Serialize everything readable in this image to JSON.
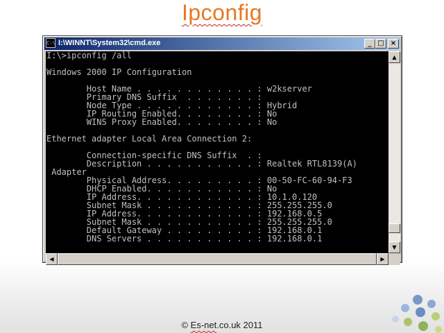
{
  "slide": {
    "title": "Ipconfig",
    "footer_pre": "© ",
    "footer_squiggle": "Es-net",
    "footer_post": ".co.uk 2011"
  },
  "window": {
    "title": "I:\\WINNT\\System32\\cmd.exe",
    "icon_text": "C:\\",
    "minimize_label": "_",
    "maximize_label": "□",
    "close_label": "×"
  },
  "console": {
    "lines": [
      "I:\\>ipconfig /all",
      "",
      "Windows 2000 IP Configuration",
      "",
      "        Host Name . . . . . . . . . . . . : w2kserver",
      "        Primary DNS Suffix  . . . . . . . :",
      "        Node Type . . . . . . . . . . . . : Hybrid",
      "        IP Routing Enabled. . . . . . . . : No",
      "        WINS Proxy Enabled. . . . . . . . : No",
      "",
      "Ethernet adapter Local Area Connection 2:",
      "",
      "        Connection-specific DNS Suffix  . :",
      "        Description . . . . . . . . . . . : Realtek RTL8139(A)",
      " Adapter",
      "        Physical Address. . . . . . . . . : 00-50-FC-60-94-F3",
      "        DHCP Enabled. . . . . . . . . . . : No",
      "        IP Address. . . . . . . . . . . . : 10.1.0.120",
      "        Subnet Mask . . . . . . . . . . . : 255.255.255.0",
      "        IP Address. . . . . . . . . . . . : 192.168.0.5",
      "        Subnet Mask . . . . . . . . . . . : 255.255.255.0",
      "        Default Gateway . . . . . . . . . : 192.168.0.1",
      "        DNS Servers . . . . . . . . . . . : 192.168.0.1"
    ]
  },
  "scrollbars": {
    "up_arrow": "▲",
    "down_arrow": "▼",
    "left_arrow": "◀",
    "right_arrow": "▶",
    "vertical_position": 0.95
  },
  "colors": {
    "title": "#e87722",
    "console_bg": "#000000",
    "console_text": "#c0c0c0",
    "titlebar_start": "#0a246a",
    "titlebar_end": "#a6caf0"
  }
}
